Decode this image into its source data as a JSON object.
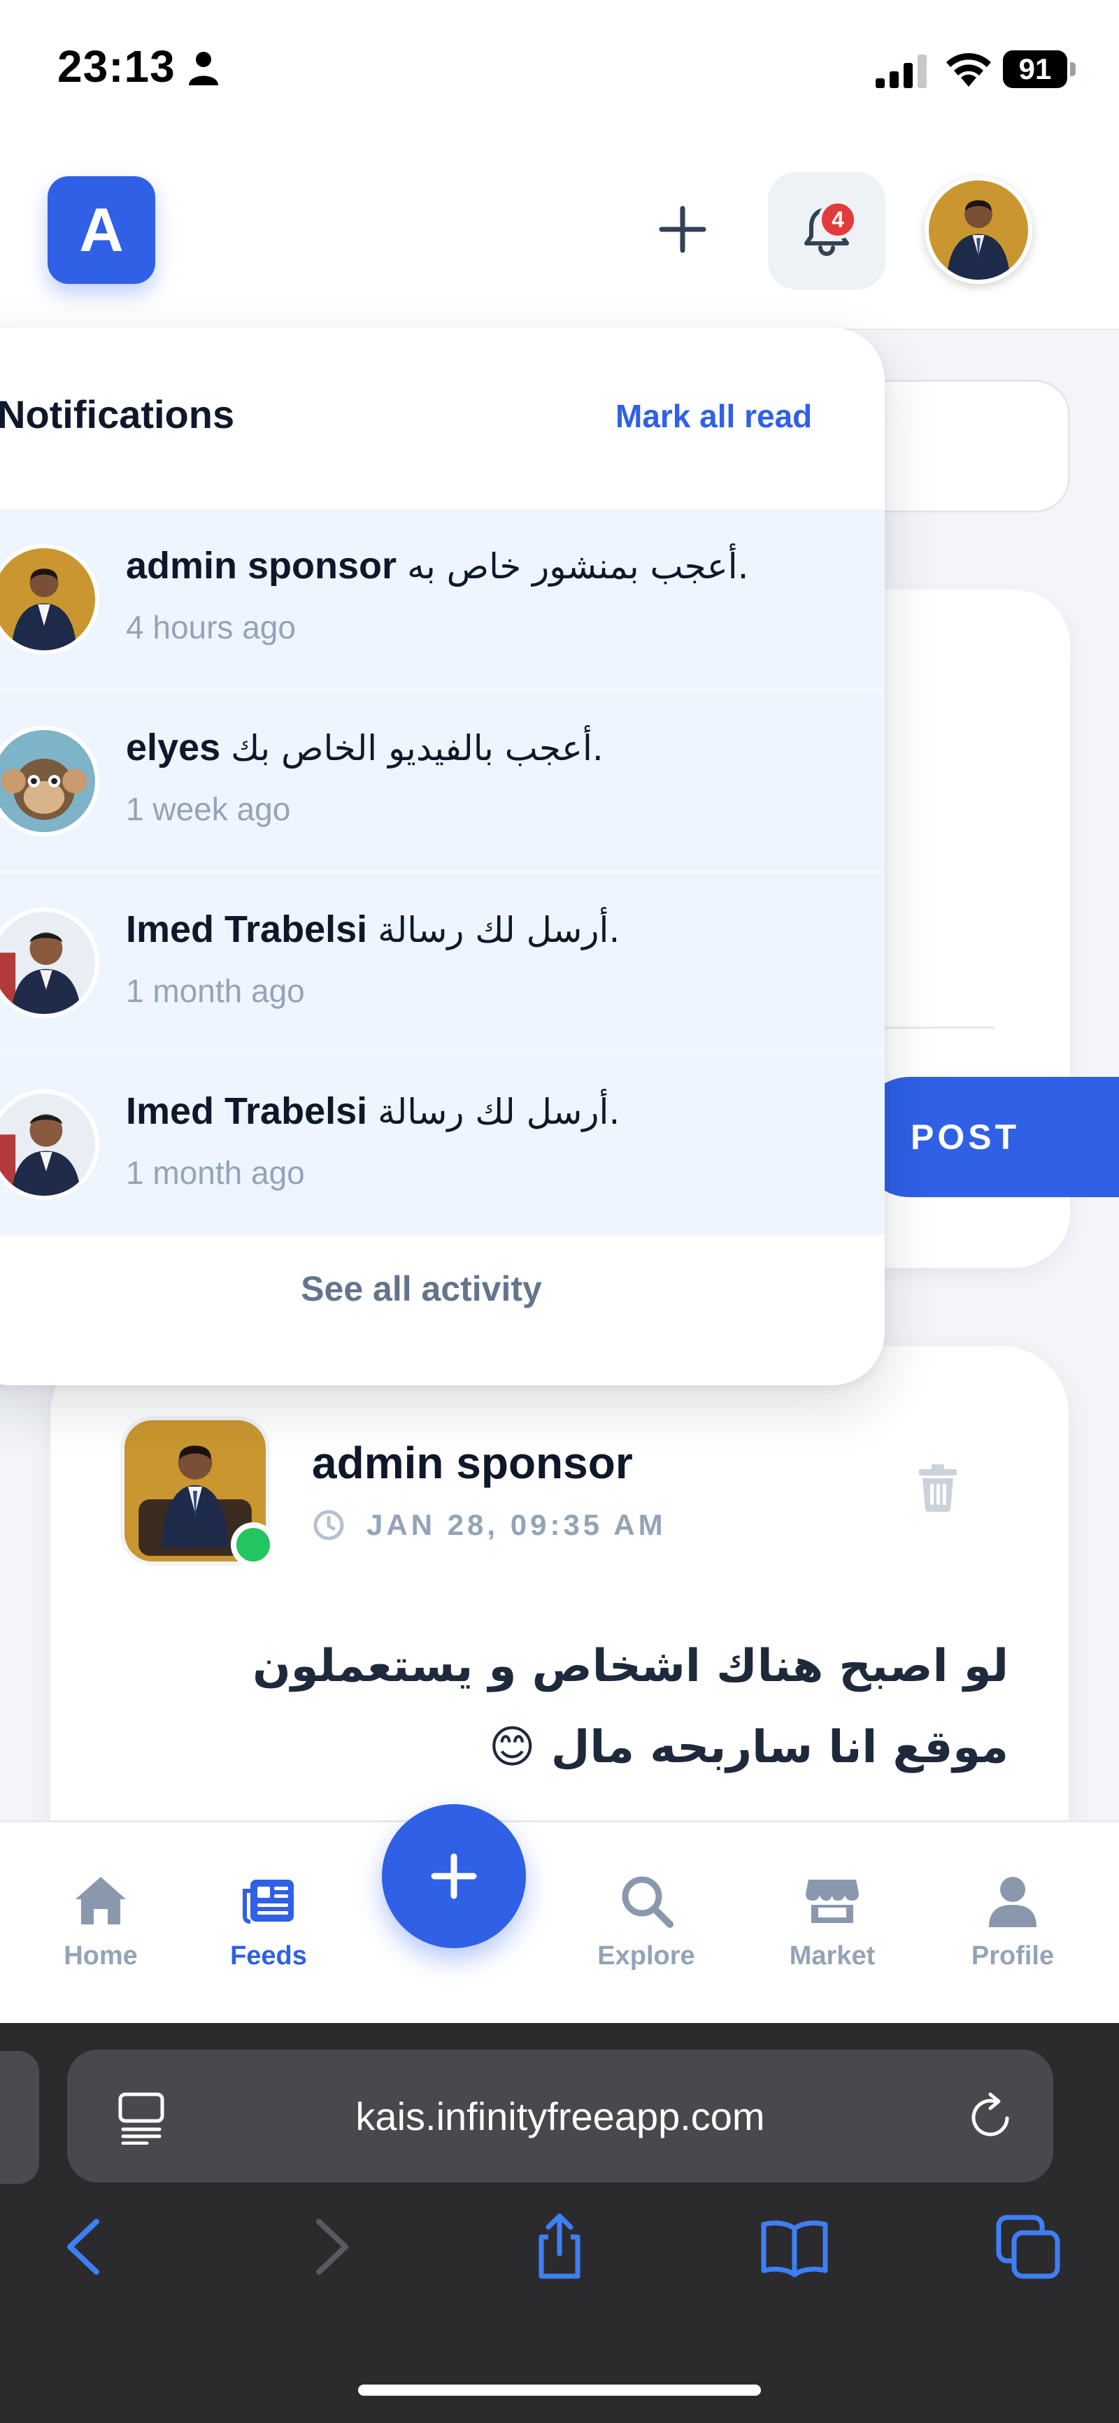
{
  "status_bar": {
    "time": "23:13",
    "battery": "91"
  },
  "header": {
    "logo_letter": "A",
    "notification_count": "4"
  },
  "notifications": {
    "title": "Notifications",
    "mark_all_label": "Mark all read",
    "items": [
      {
        "name": "admin sponsor",
        "action": "أعجب بمنشور خاص به.",
        "time": "4 hours ago"
      },
      {
        "name": "elyes",
        "action": "أعجب بالفيديو الخاص بك.",
        "time": "1 week ago"
      },
      {
        "name": "Imed Trabelsi",
        "action": "أرسل لك رسالة.",
        "time": "1 month ago"
      },
      {
        "name": "Imed Trabelsi",
        "action": "أرسل لك رسالة.",
        "time": "1 month ago"
      }
    ],
    "see_all_label": "See all activity"
  },
  "composer": {
    "post_label": "POST"
  },
  "post": {
    "author": "admin sponsor",
    "timestamp": "JAN 28, 09:35 AM",
    "text": "لو اصبح هناك اشخاص و يستعملون موقع انا ساربحه مال 😊"
  },
  "bottom_nav": {
    "items": [
      {
        "label": "Home",
        "icon": "home-icon"
      },
      {
        "label": "Feeds",
        "icon": "feeds-icon"
      },
      {
        "label": "Explore",
        "icon": "search-icon"
      },
      {
        "label": "Market",
        "icon": "store-icon"
      },
      {
        "label": "Profile",
        "icon": "user-icon"
      }
    ],
    "active": "Feeds"
  },
  "browser": {
    "url": "kais.infinityfreeapp.com"
  },
  "colors": {
    "accent": "#2f60e6",
    "badge": "#e23b3b",
    "online": "#22c55e",
    "notif_bg": "#eef5ff"
  }
}
